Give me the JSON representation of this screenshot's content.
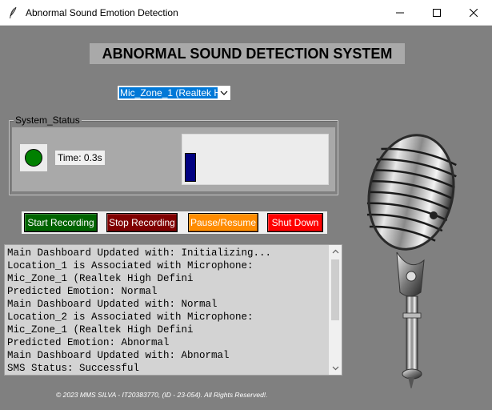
{
  "window": {
    "title": "Abnormal Sound Emotion Detection",
    "icon": "feather-icon",
    "controls": [
      "minimize-icon",
      "maximize-icon",
      "close-icon"
    ]
  },
  "heading": "ABNORMAL SOUND DETECTION SYSTEM",
  "mic_select": {
    "selected": "Mic_Zone_1 (Realtek H"
  },
  "status": {
    "legend": "System_Status",
    "light_color": "#008000",
    "time_label": "Time: 0.3s",
    "progress_fraction": 0.08
  },
  "buttons": {
    "start": "Start Recording",
    "stop": "Stop Recording",
    "pause": "Pause/Resume",
    "shutdown": "Shut Down"
  },
  "log_lines": [
    "Main Dashboard Updated with: Initializing...",
    "Location_1 is Associated with Microphone:",
    "Mic_Zone_1 (Realtek High Defini",
    "Predicted Emotion: Normal",
    "Main Dashboard Updated with: Normal",
    "Location_2 is Associated with Microphone:",
    "Mic_Zone_1 (Realtek High Defini",
    "Predicted Emotion: Abnormal",
    "Main Dashboard Updated with: Abnormal",
    "SMS Status: Successful"
  ],
  "footer": "© 2023 MMS SILVA - IT20383770, (ID - 23-054). All Rights Reserved!.",
  "colors": {
    "background": "#808080",
    "start": "#006400",
    "stop": "#800000",
    "pause": "#ff8c00",
    "shutdown": "#ff0000",
    "progress": "#000080"
  }
}
